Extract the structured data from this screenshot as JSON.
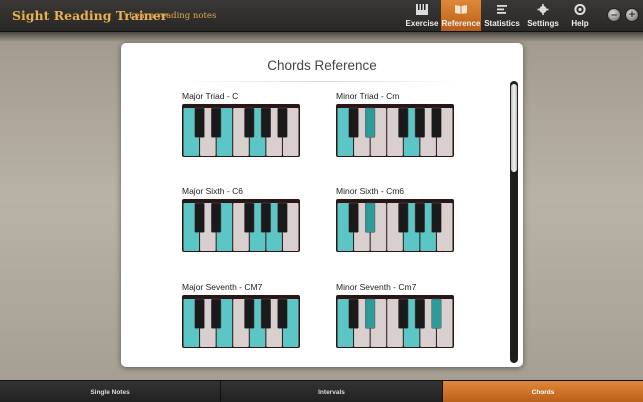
{
  "app": {
    "title": "Sight Reading Trainer",
    "subtitle": "Learn reading notes"
  },
  "nav": [
    {
      "label": "Exercise",
      "icon": "piano-keys-icon",
      "active": false
    },
    {
      "label": "Reference",
      "icon": "book-icon",
      "active": true
    },
    {
      "label": "Statistics",
      "icon": "bars-icon",
      "active": false
    },
    {
      "label": "Settings",
      "icon": "gear-icon",
      "active": false
    },
    {
      "label": "Help",
      "icon": "lifebuoy-icon",
      "active": false
    }
  ],
  "window_controls": {
    "minimize": "–",
    "close": "+"
  },
  "panel": {
    "title": "Chords Reference"
  },
  "chords": [
    {
      "label": "Major Triad - C",
      "white_highlight": [
        0,
        2,
        4
      ],
      "black_highlight": []
    },
    {
      "label": "Minor Triad - Cm",
      "white_highlight": [
        0,
        4
      ],
      "black_highlight": [
        1
      ]
    },
    {
      "label": "Major Sixth - C6",
      "white_highlight": [
        0,
        2,
        4,
        5
      ],
      "black_highlight": []
    },
    {
      "label": "Minor Sixth - Cm6",
      "white_highlight": [
        0,
        4,
        5
      ],
      "black_highlight": [
        1
      ]
    },
    {
      "label": "Major Seventh - CM7",
      "white_highlight": [
        0,
        2,
        4,
        6
      ],
      "black_highlight": []
    },
    {
      "label": "Minor Seventh - Cm7",
      "white_highlight": [
        0,
        4
      ],
      "black_highlight": [
        1,
        4
      ]
    }
  ],
  "bottom_tabs": [
    {
      "label": "Single Notes",
      "active": false
    },
    {
      "label": "Intervals",
      "active": false
    },
    {
      "label": "Chords",
      "active": true
    }
  ],
  "colors": {
    "accent": "#d2782a",
    "title_gold": "#e8b050",
    "key_highlight": "#5cc6c6",
    "key_white": "#d9cfcf",
    "key_black": "#1a1a1a"
  }
}
